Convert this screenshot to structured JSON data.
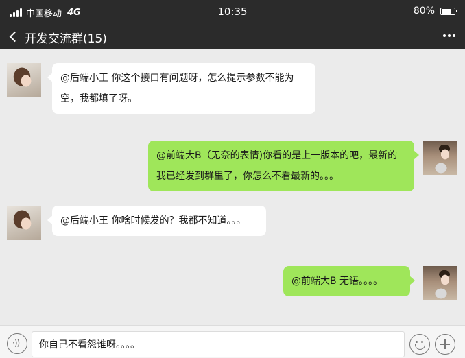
{
  "status_bar": {
    "carrier": "中国移动",
    "network": "4G",
    "time": "10:35",
    "battery": "80%",
    "battery_level": 0.8
  },
  "header": {
    "title": "开发交流群(15)",
    "back_icon": "chevron-left-icon",
    "more_icon": "more-dots-icon"
  },
  "messages": [
    {
      "side": "left",
      "avatar": "girl-avatar",
      "text": "@后端小王  你这个接口有问题呀，怎么提示参数不能为空，我都填了呀。"
    },
    {
      "side": "right",
      "avatar": "boy-avatar",
      "text": "@前端大B（无奈的表情)你看的是上一版本的吧，最新的我已经发到群里了，你怎么不看最新的。。。"
    },
    {
      "side": "left",
      "avatar": "girl-avatar",
      "text": "@后端小王  你啥时候发的？我都不知道。。。"
    },
    {
      "side": "right",
      "avatar": "boy-avatar",
      "text": "@前端大B   无语。。。。"
    }
  ],
  "input_bar": {
    "value": "你自己不看怨谁呀。。。。",
    "voice_icon": "voice-icon",
    "emoji_icon": "emoji-icon",
    "plus_icon": "plus-icon"
  },
  "colors": {
    "header_bg": "#2b2b2b",
    "chat_bg": "#ebebeb",
    "bubble_self": "#9fe65a",
    "bubble_other": "#ffffff"
  }
}
